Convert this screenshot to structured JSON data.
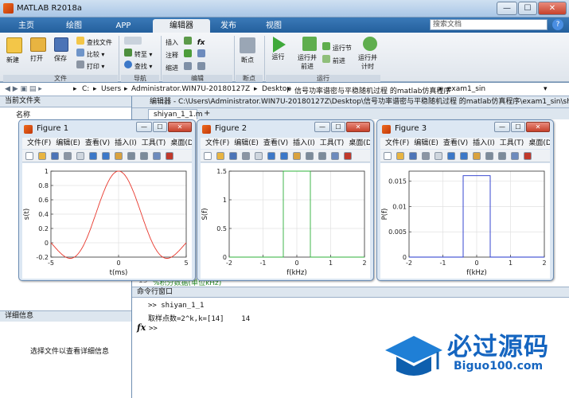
{
  "app": {
    "title": "MATLAB R2018a"
  },
  "window_buttons": {
    "minimize": "—",
    "maximize": "☐",
    "close": "✕"
  },
  "tabs": [
    {
      "label": "主页"
    },
    {
      "label": "绘图"
    },
    {
      "label": "APP"
    },
    {
      "label": "编辑器"
    },
    {
      "label": "发布"
    },
    {
      "label": "视图"
    }
  ],
  "search": {
    "placeholder": "搜索文档"
  },
  "ribbon": {
    "file": {
      "new": "新建",
      "open": "打开",
      "save": "保存",
      "find_files": "查找文件",
      "compare": "比较",
      "print": "打印",
      "group": "文件"
    },
    "nav": {
      "goto": "转至",
      "find": "查找",
      "group": "导航"
    },
    "edit": {
      "insert": "插入",
      "comment": "注释",
      "indent": "缩进",
      "group": "编辑"
    },
    "breakpoints": {
      "label": "断点",
      "group": "断点"
    },
    "run": {
      "run": "运行",
      "run_advance": "运行并\n前进",
      "run_section": "运行节",
      "advance": "前进",
      "run_time": "运行并\n计时",
      "group": "运行"
    }
  },
  "address": {
    "path": [
      "C:",
      "Users",
      "Administrator.WIN7U-20180127Z",
      "Desktop",
      "信号功率谱密与平稳随机过程 的matlab仿真程序",
      "exam1_sin"
    ]
  },
  "current_folder": {
    "title": "当前文件夹",
    "column": "名称"
  },
  "details": {
    "title": "详细信息",
    "message": "选择文件以查看详细信息"
  },
  "editor": {
    "header": "编辑器 - C:\\Users\\Administrator.WIN7U-20180127Z\\Desktop\\信号功率谱密与平稳随机过程 的matlab仿真程序\\exam1_sin\\shiyan_1_1.m",
    "tab": "shiyan_1_1.m",
    "partial_line_no": "15",
    "partial_line": "%积分数据(单位kHz)"
  },
  "command_window": {
    "title": "命令行窗口",
    "lines": [
      ">> shiyan_1_1",
      "取样点数=2^k,k=[14]    14"
    ],
    "prompt": ">>",
    "fx": "fx"
  },
  "figure_menu": [
    "文件(F)",
    "编辑(E)",
    "查看(V)",
    "插入(I)",
    "工具(T)",
    "桌面(D)",
    "窗口(W)",
    "帮助(H)"
  ],
  "figures": [
    {
      "title": "Figure 1"
    },
    {
      "title": "Figure 2"
    },
    {
      "title": "Figure 3"
    }
  ],
  "chart_data": [
    {
      "type": "line",
      "xlabel": "t(ms)",
      "ylabel": "s(t)",
      "xlim": [
        -5,
        5
      ],
      "ylim": [
        -0.2,
        1
      ],
      "xticks": [
        -5,
        0,
        5
      ],
      "yticks": [
        -0.2,
        0,
        0.2,
        0.4,
        0.6,
        0.8,
        1
      ],
      "yticklabels": [
        "-0.2",
        "0",
        "0.2",
        "0.4",
        "0.6",
        "0.8",
        "1"
      ],
      "grid": true,
      "color": "#e8372c",
      "series": [
        {
          "func": "sinc",
          "x_start": -5,
          "x_end": 5,
          "period": 2.5
        }
      ]
    },
    {
      "type": "line",
      "xlabel": "f(kHz)",
      "ylabel": "S(f)",
      "xlim": [
        -2,
        2
      ],
      "ylim": [
        0,
        1.5
      ],
      "xticks": [
        -2,
        -1,
        0,
        1,
        2
      ],
      "yticks": [
        0,
        0.5,
        1,
        1.5
      ],
      "yticklabels": [
        "0",
        "0.5",
        "1",
        "1.5"
      ],
      "grid": true,
      "color": "#2db03a",
      "series": [
        {
          "x": [
            -2,
            -0.4,
            -0.4,
            0.4,
            0.4,
            2
          ],
          "y": [
            0,
            0,
            1.5,
            1.5,
            0,
            0
          ]
        }
      ]
    },
    {
      "type": "line",
      "xlabel": "f(kHz)",
      "ylabel": "P(f)",
      "xlim": [
        -2,
        2
      ],
      "ylim": [
        0,
        0.017
      ],
      "xticks": [
        -2,
        -1,
        0,
        1,
        2
      ],
      "yticks": [
        0,
        0.005,
        0.01,
        0.015
      ],
      "yticklabels": [
        "0",
        "0.005",
        "0.01",
        "0.015"
      ],
      "grid": true,
      "color": "#2233cc",
      "series": [
        {
          "x": [
            -2,
            -0.4,
            -0.4,
            0.4,
            0.4,
            2
          ],
          "y": [
            0,
            0,
            0.0161,
            0.0161,
            0,
            0
          ]
        }
      ]
    }
  ],
  "watermark": {
    "text": "必过源码",
    "sub": "Biguo100.com"
  }
}
